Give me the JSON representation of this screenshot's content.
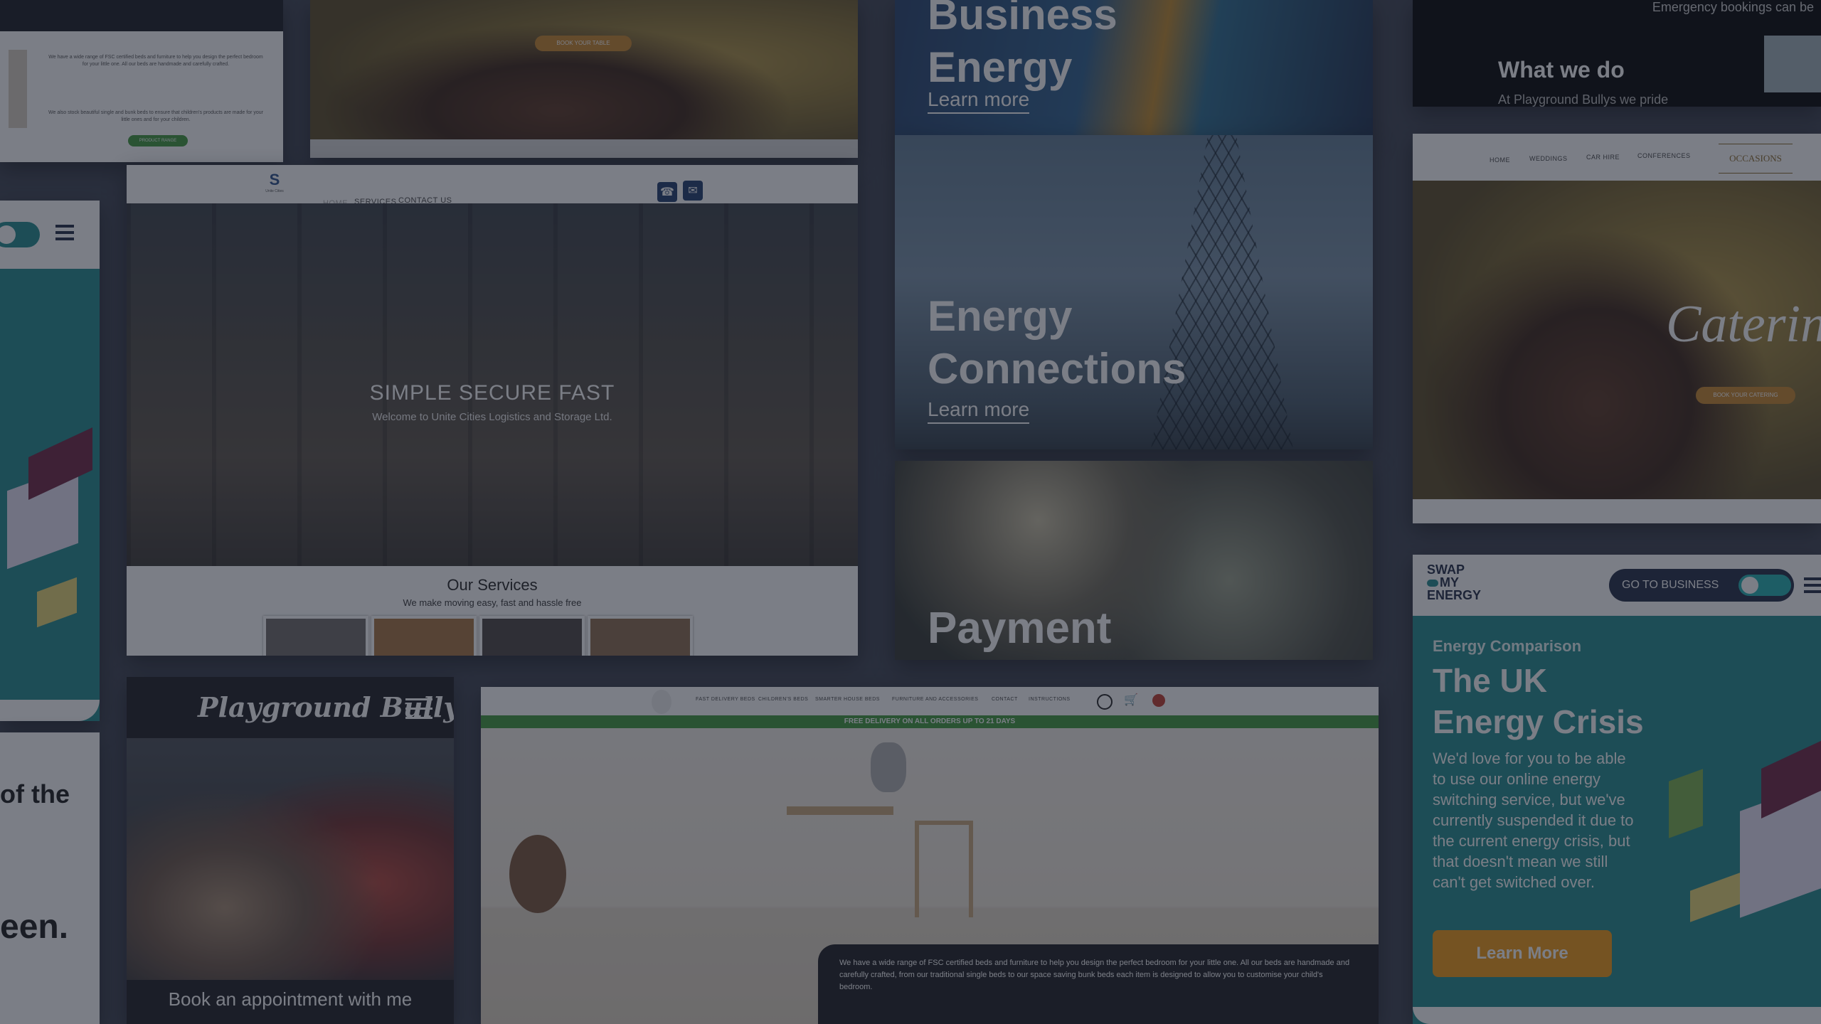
{
  "tiles": {
    "beds_text": {
      "paragraph1": "We have a wide range of FSC certified beds and furniture to help you design the perfect bedroom for your little one. All our beds are handmade and carefully crafted.",
      "paragraph2": "We also stock beautiful single and bunk beds to ensure that children's products are made for your little ones and for your children.",
      "button": "PRODUCT RANGE"
    },
    "food_top": {
      "button": "BOOK YOUR TABLE"
    },
    "business_energy": {
      "title_line1": "Business",
      "title_line2": "Energy",
      "link": "Learn more"
    },
    "what_we_do": {
      "top_text": "Emergency bookings can be",
      "heading": "What we do",
      "sub": "At Playground Bullys we pride"
    },
    "toggle_small": {
      "menu_icon": "hamburger-icon"
    },
    "logistics": {
      "nav": [
        "HOME",
        "SERVICES",
        "CONTACT US"
      ],
      "logo_text": "Unite Cities",
      "hero_title": "SIMPLE SECURE FAST",
      "hero_sub": "Welcome to Unite Cities Logistics and Storage Ltd.",
      "services_title": "Our Services",
      "services_sub": "We make moving easy, fast and hassle free"
    },
    "energy_connections": {
      "title_line1": "Energy",
      "title_line2": "Connections",
      "link": "Learn more"
    },
    "payment": {
      "title": "Payment"
    },
    "catering": {
      "nav": [
        "HOME",
        "WEDDINGS",
        "CAR HIRE",
        "CONFERENCES"
      ],
      "logo_text": "OCCASIONS",
      "script_title": "Catering",
      "button": "BOOK YOUR CATERING"
    },
    "swap_energy": {
      "logo_line1": "SWAP",
      "logo_line2": "MY",
      "logo_line3": "ENERGY",
      "toggle_label": "GO TO BUSINESS",
      "eyebrow": "Energy Comparison",
      "title_line1": "The UK",
      "title_line2": "Energy Crisis",
      "body": "We'd love for you to be able to use our online energy switching service, but we've currently suspended it due to the current energy crisis, but that doesn't mean we still can't get switched over.",
      "button": "Learn More"
    },
    "left_strip": {
      "text1": "of the",
      "text2": "een."
    },
    "bullys": {
      "logo": "Playground Bullys",
      "cta": "Book an appointment with me"
    },
    "kids_beds": {
      "nav": [
        "FAST DELIVERY BEDS",
        "CHILDREN'S BEDS",
        "SMARTER HOUSE BEDS",
        "FURNITURE AND ACCESSORIES",
        "CONTACT",
        "INSTRUCTIONS"
      ],
      "banner": "FREE DELIVERY ON ALL ORDERS UP TO 21 DAYS",
      "overlay_text": "We have a wide range of FSC certified beds and furniture to help you design the perfect bedroom for your little one. All our beds are handmade and carefully crafted, from our traditional single beds to our space saving bunk beds each item is designed to allow you to customise your child's bedroom."
    }
  },
  "colors": {
    "backdrop": "#3e4352",
    "swap_teal": "#1f8b8d",
    "swap_orange": "#f19a12",
    "kids_green": "#3f9a3a",
    "bullys_dark": "#1b1b1f"
  }
}
